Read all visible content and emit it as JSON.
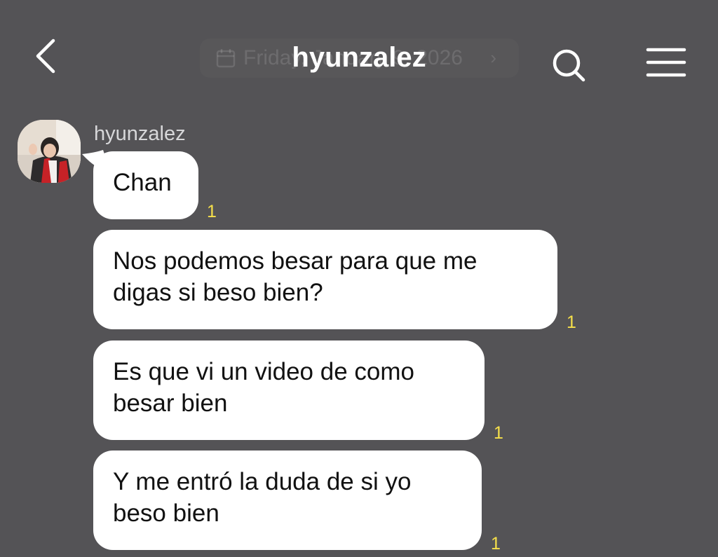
{
  "header": {
    "title": "hyunzalez",
    "date_banner": "Friday, January 9, 2026",
    "back_icon": "chevron-left-icon",
    "search_icon": "search-icon",
    "menu_icon": "hamburger-menu-icon"
  },
  "chat": {
    "sender_name": "hyunzalez",
    "messages": [
      {
        "text": "Chan",
        "unread": "1"
      },
      {
        "text": "Nos podemos besar para que me\ndigas si beso bien?",
        "unread": "1"
      },
      {
        "text": "Es que vi un video de como\nbesar bien",
        "unread": "1"
      },
      {
        "text": "Y me entró la duda de si yo\nbeso bien",
        "unread": "1"
      }
    ]
  },
  "colors": {
    "background": "#545356",
    "bubble": "#ffffff",
    "unread": "#f6e04a"
  }
}
